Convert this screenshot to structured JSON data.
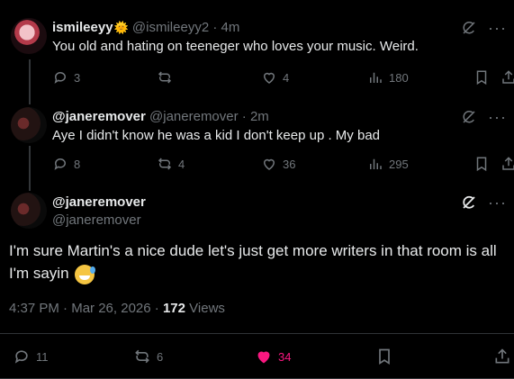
{
  "replies": [
    {
      "name": "ismileeyy",
      "name_emoji": "🌞",
      "handle": "@ismileeyy2",
      "time": "4m",
      "text": "You old and hating on teeneger who loves your music.  Weird.",
      "replies": "3",
      "reposts": "",
      "likes": "4",
      "views": "180"
    },
    {
      "name": "@janeremover",
      "handle": "@janeremover",
      "time": "2m",
      "text": "Aye I didn't know he was a kid I don't keep up . My bad",
      "replies": "8",
      "reposts": "4",
      "likes": "36",
      "views": "295"
    }
  ],
  "main_post": {
    "name": "@janeremover",
    "handle": "@janeremover",
    "text_line1": "I'm sure Martin's a nice dude let's just get more writers in that room is all",
    "text_line2": "I'm sayin",
    "emoji": "grinning-sweat-emoji",
    "time": "4:37 PM",
    "date": "Mar 26, 2026",
    "views_count": "172",
    "views_label": "Views",
    "replies": "11",
    "reposts": "6",
    "likes": "34",
    "like_color": "#f91880"
  },
  "separator": "·",
  "icons": [
    "grok-icon",
    "more-icon",
    "reply-icon",
    "repost-icon",
    "like-icon",
    "views-icon",
    "bookmark-icon",
    "share-icon"
  ]
}
